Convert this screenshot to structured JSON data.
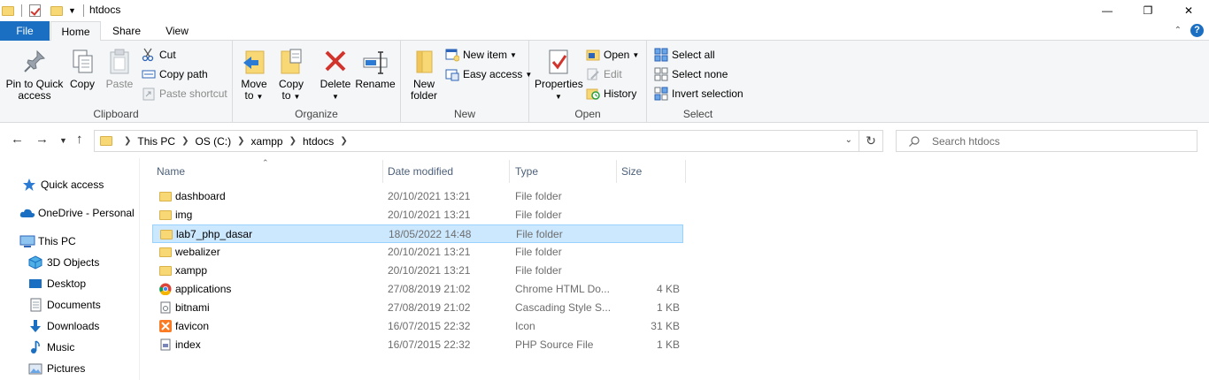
{
  "window": {
    "title": "htdocs",
    "buttons": {
      "minimize": "—",
      "maximize": "❐",
      "close": "✕"
    }
  },
  "ribbon_tabs": {
    "file": "File",
    "home": "Home",
    "share": "Share",
    "view": "View",
    "collapse": "^",
    "help": "?"
  },
  "ribbon": {
    "clipboard": {
      "label": "Clipboard",
      "pin": "Pin to Quick access",
      "copy": "Copy",
      "paste": "Paste",
      "cut": "Cut",
      "copy_path": "Copy path",
      "paste_shortcut": "Paste shortcut"
    },
    "organize": {
      "label": "Organize",
      "move_to": "Move to",
      "copy_to": "Copy to",
      "delete": "Delete",
      "rename": "Rename"
    },
    "new": {
      "label": "New",
      "new_folder": "New folder",
      "new_item": "New item",
      "easy_access": "Easy access"
    },
    "open": {
      "label": "Open",
      "properties": "Properties",
      "open": "Open",
      "edit": "Edit",
      "history": "History"
    },
    "select": {
      "label": "Select",
      "select_all": "Select all",
      "select_none": "Select none",
      "invert_selection": "Invert selection"
    }
  },
  "address": {
    "crumbs": [
      "This PC",
      "OS (C:)",
      "xampp",
      "htdocs"
    ],
    "search_placeholder": "Search htdocs"
  },
  "nav_pane": {
    "items": [
      "Quick access",
      "OneDrive - Personal",
      "This PC",
      "3D Objects",
      "Desktop",
      "Documents",
      "Downloads",
      "Music",
      "Pictures"
    ]
  },
  "file_list": {
    "columns": {
      "name": "Name",
      "date": "Date modified",
      "type": "Type",
      "size": "Size"
    },
    "rows": [
      {
        "name": "dashboard",
        "date": "20/10/2021 13:21",
        "type": "File folder",
        "size": "",
        "icon": "folder-icon"
      },
      {
        "name": "img",
        "date": "20/10/2021 13:21",
        "type": "File folder",
        "size": "",
        "icon": "folder-icon"
      },
      {
        "name": "lab7_php_dasar",
        "date": "18/05/2022 14:48",
        "type": "File folder",
        "size": "",
        "icon": "folder-icon"
      },
      {
        "name": "webalizer",
        "date": "20/10/2021 13:21",
        "type": "File folder",
        "size": "",
        "icon": "folder-icon"
      },
      {
        "name": "xampp",
        "date": "20/10/2021 13:21",
        "type": "File folder",
        "size": "",
        "icon": "folder-icon"
      },
      {
        "name": "applications",
        "date": "27/08/2019 21:02",
        "type": "Chrome HTML Do...",
        "size": "4 KB",
        "icon": "chrome-icon"
      },
      {
        "name": "bitnami",
        "date": "27/08/2019 21:02",
        "type": "Cascading Style S...",
        "size": "1 KB",
        "icon": "css-file-icon"
      },
      {
        "name": "favicon",
        "date": "16/07/2015 22:32",
        "type": "Icon",
        "size": "31 KB",
        "icon": "xampp-icon"
      },
      {
        "name": "index",
        "date": "16/07/2015 22:32",
        "type": "PHP Source File",
        "size": "1 KB",
        "icon": "php-file-icon"
      }
    ],
    "selected_row": "lab7_php_dasar"
  },
  "colors": {
    "file_tab": "#1a6fc2",
    "selection_bg": "#cce8ff",
    "selection_border": "#99d1ff",
    "folder_yellow": "#f8d775",
    "delete_red": "#d0342c"
  }
}
